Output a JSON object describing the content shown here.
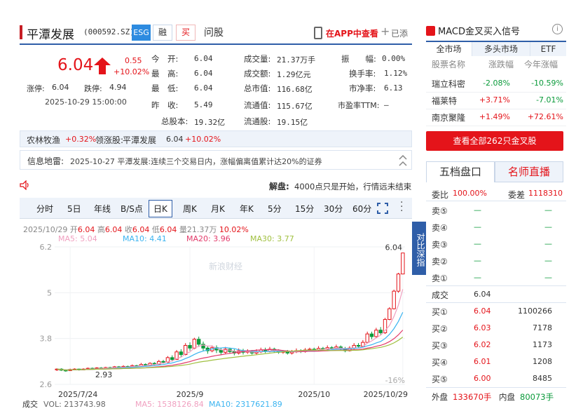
{
  "stock": {
    "name": "平潭发展",
    "code": "(000592.SZ)",
    "tags": [
      "ESG",
      "融",
      "买"
    ],
    "ask_link": "问股",
    "app_link": "在APP中查看",
    "added": "已添",
    "price": "6.04",
    "change": "0.55",
    "change_pct": "+10.02%",
    "limit_up_label": "涨停:",
    "limit_up": "6.04",
    "limit_down_label": "跌停:",
    "limit_down": "4.94",
    "datetime": "2025-10-29 15:00:00"
  },
  "quote": {
    "open_label": "今　开:",
    "open": "6.04",
    "high_label": "最　高:",
    "high": "6.04",
    "low_label": "最　低:",
    "low": "6.04",
    "prev_label": "昨　收:",
    "prev": "5.49",
    "vol_label": "成交量:",
    "vol": "21.37万手",
    "amt_label": "成交额:",
    "amt": "1.29亿元",
    "mcap_label": "总市值:",
    "mcap": "116.68亿",
    "fmcap_label": "流通值:",
    "fmcap": "115.67亿",
    "fshares_label": "流通股:",
    "fshares": "19.15亿",
    "tshares_label": "总股本:",
    "tshares": "19.32亿",
    "amp_label": "振　　幅:",
    "amp": "0.00%",
    "turn_label": "换手率:",
    "turn": "1.12%",
    "pb_label": "市净率:",
    "pb": "6.13",
    "pe_label": "市盈率TTM:",
    "pe": "—"
  },
  "sector": {
    "name": "农林牧渔",
    "pct": "+0.32%",
    "leader_label": "领涨股:",
    "leader": "平潭发展",
    "leader_price": "6.04",
    "leader_pct": "+10.02%"
  },
  "thunder": {
    "label": "信息地雷:",
    "text": "2025-10-27 平潭发展:连续三个交易日内，涨幅偏离值累计达20%的证券"
  },
  "notice": {
    "label": "解盘:",
    "text": "4000点只是开始，行情远未结束"
  },
  "tabs": [
    "分时",
    "5日",
    "年线",
    "B/S点",
    "日K",
    "周K",
    "月K",
    "年K",
    "5分",
    "15分",
    "30分",
    "60分"
  ],
  "chart_info": {
    "date": "2025/10/29",
    "open_label": "开",
    "open": "6.04",
    "high_label": "高",
    "high": "6.04",
    "close_label": "收",
    "close": "6.04",
    "low_label": "低",
    "low": "6.04",
    "vol_label": "量",
    "vol": "21.37万",
    "pct": "10.02%",
    "ma5": "MA5: 5.04",
    "ma10": "MA10: 4.41",
    "ma20": "MA20: 3.96",
    "ma30": "MA30: 3.77",
    "side_btn": "对比深指",
    "watermark": "新浪财经",
    "vol_title": "成交",
    "vol_val": "VOL: 213743.98",
    "vol_ma5": "MA5: 1538126.84",
    "vol_ma10": "MA10: 2317621.89",
    "low_marker": "2.93",
    "high_marker": "6.04",
    "pct_marker": "-16%",
    "colors": {
      "ma5": "#f0a0c0",
      "ma10": "#3bb4f0",
      "ma20": "#e23a6a",
      "ma30": "#a0c040",
      "up": "#e4141a",
      "down": "#0a9a3a"
    }
  },
  "chart_data": {
    "type": "candlestick",
    "y_ticks": [
      "6.2",
      "5",
      "3.8",
      "2.6"
    ],
    "ylim": [
      2.6,
      6.2
    ],
    "x_ticks": [
      "2025/7/24",
      "2025/9",
      "2025/10",
      "2025/10/29"
    ],
    "candles": [
      [
        2.98,
        3.0,
        2.95,
        3.02
      ],
      [
        3.0,
        2.97,
        2.95,
        3.02
      ],
      [
        2.97,
        2.96,
        2.93,
        2.99
      ],
      [
        2.96,
        2.99,
        2.95,
        3.01
      ],
      [
        2.99,
        3.0,
        2.97,
        3.02
      ],
      [
        3.0,
        2.98,
        2.96,
        3.01
      ],
      [
        2.98,
        3.0,
        2.97,
        3.02
      ],
      [
        3.0,
        3.02,
        2.99,
        3.04
      ],
      [
        3.02,
        3.01,
        2.99,
        3.04
      ],
      [
        3.01,
        3.03,
        3.0,
        3.05
      ],
      [
        3.03,
        3.02,
        3.0,
        3.05
      ],
      [
        3.02,
        3.04,
        3.01,
        3.06
      ],
      [
        3.04,
        3.03,
        3.01,
        3.06
      ],
      [
        3.03,
        3.06,
        3.02,
        3.08
      ],
      [
        3.06,
        3.05,
        3.03,
        3.08
      ],
      [
        3.05,
        3.07,
        3.04,
        3.1
      ],
      [
        3.07,
        3.06,
        3.04,
        3.09
      ],
      [
        3.06,
        3.09,
        3.05,
        3.12
      ],
      [
        3.09,
        3.08,
        3.06,
        3.11
      ],
      [
        3.08,
        3.12,
        3.07,
        3.16
      ],
      [
        3.12,
        3.1,
        3.08,
        3.15
      ],
      [
        3.1,
        3.15,
        3.09,
        3.18
      ],
      [
        3.15,
        3.13,
        3.1,
        3.18
      ],
      [
        3.13,
        3.2,
        3.12,
        3.24
      ],
      [
        3.2,
        3.18,
        3.14,
        3.24
      ],
      [
        3.18,
        3.3,
        3.16,
        3.34
      ],
      [
        3.3,
        3.25,
        3.2,
        3.36
      ],
      [
        3.25,
        3.45,
        3.24,
        3.5
      ],
      [
        3.45,
        3.38,
        3.32,
        3.52
      ],
      [
        3.38,
        3.62,
        3.36,
        3.68
      ],
      [
        3.62,
        3.55,
        3.48,
        3.7
      ],
      [
        3.55,
        3.78,
        3.52,
        3.82
      ],
      [
        3.78,
        3.65,
        3.58,
        3.85
      ],
      [
        3.65,
        3.55,
        3.48,
        3.72
      ],
      [
        3.55,
        3.48,
        3.4,
        3.6
      ],
      [
        3.48,
        3.56,
        3.44,
        3.62
      ],
      [
        3.56,
        3.5,
        3.42,
        3.62
      ],
      [
        3.5,
        3.44,
        3.38,
        3.56
      ],
      [
        3.44,
        3.52,
        3.4,
        3.58
      ],
      [
        3.52,
        3.46,
        3.4,
        3.56
      ],
      [
        3.46,
        3.42,
        3.36,
        3.52
      ],
      [
        3.42,
        3.48,
        3.38,
        3.54
      ],
      [
        3.48,
        3.44,
        3.38,
        3.53
      ],
      [
        3.44,
        3.46,
        3.4,
        3.52
      ],
      [
        3.46,
        3.42,
        3.38,
        3.5
      ],
      [
        3.42,
        3.45,
        3.38,
        3.52
      ],
      [
        3.45,
        3.5,
        3.42,
        3.56
      ],
      [
        3.5,
        3.47,
        3.42,
        3.56
      ],
      [
        3.47,
        3.52,
        3.44,
        3.58
      ],
      [
        3.52,
        3.48,
        3.43,
        3.56
      ],
      [
        3.48,
        3.44,
        3.4,
        3.52
      ],
      [
        3.44,
        3.46,
        3.4,
        3.5
      ],
      [
        3.46,
        3.42,
        3.38,
        3.5
      ],
      [
        3.42,
        3.45,
        3.38,
        3.5
      ],
      [
        3.45,
        3.48,
        3.42,
        3.54
      ],
      [
        3.48,
        3.46,
        3.42,
        3.52
      ],
      [
        3.46,
        3.5,
        3.43,
        3.55
      ],
      [
        3.5,
        3.52,
        3.46,
        3.56
      ],
      [
        3.52,
        3.5,
        3.46,
        3.56
      ],
      [
        3.5,
        3.54,
        3.48,
        3.6
      ],
      [
        3.54,
        3.52,
        3.48,
        3.58
      ],
      [
        3.52,
        3.56,
        3.49,
        3.62
      ],
      [
        3.56,
        3.54,
        3.5,
        3.6
      ],
      [
        3.54,
        3.58,
        3.52,
        3.64
      ],
      [
        3.58,
        3.54,
        3.5,
        3.62
      ],
      [
        3.54,
        3.48,
        3.44,
        3.58
      ],
      [
        3.48,
        3.55,
        3.46,
        3.6
      ],
      [
        3.55,
        3.62,
        3.52,
        3.68
      ],
      [
        3.62,
        3.6,
        3.55,
        3.68
      ],
      [
        3.6,
        3.7,
        3.58,
        3.76
      ],
      [
        3.7,
        3.92,
        3.68,
        3.98
      ],
      [
        3.92,
        3.85,
        3.78,
        3.98
      ],
      [
        3.85,
        4.02,
        3.82,
        4.08
      ],
      [
        4.02,
        3.95,
        3.9,
        4.1
      ],
      [
        3.95,
        4.3,
        3.92,
        4.34
      ],
      [
        4.3,
        4.58,
        4.28,
        4.62
      ],
      [
        4.58,
        5.04,
        4.56,
        5.08
      ],
      [
        5.04,
        5.49,
        5.0,
        5.52
      ],
      [
        5.49,
        6.04,
        5.49,
        6.04
      ]
    ]
  },
  "right_panel": {
    "signal_title": "MACD金叉买入信号",
    "info_icon": "i",
    "tabs": [
      "全市场",
      "多头市场",
      "ETF"
    ],
    "headers": [
      "股票名称",
      "涨跌幅",
      "今年涨幅"
    ],
    "rows": [
      {
        "name": "瑞立科密",
        "chg": "-2.08%",
        "ytd": "-10.59%",
        "chg_up": false,
        "ytd_up": false
      },
      {
        "name": "福莱特",
        "chg": "+3.71%",
        "ytd": "-7.01%",
        "chg_up": true,
        "ytd_up": false
      },
      {
        "name": "南京聚隆",
        "chg": "+1.49%",
        "ytd": "+72.61%",
        "chg_up": true,
        "ytd_up": true
      }
    ],
    "view_all": "查看全部262只金叉股",
    "book_tabs": [
      "五档盘口",
      "名师直播"
    ],
    "weibi_label": "委比",
    "weibi": "100.00%",
    "weicha_label": "委差",
    "weicha": "1118310",
    "sells": [
      {
        "label": "卖⑤",
        "price": "—",
        "vol": "—"
      },
      {
        "label": "卖④",
        "price": "—",
        "vol": "—"
      },
      {
        "label": "卖③",
        "price": "—",
        "vol": "—"
      },
      {
        "label": "卖②",
        "price": "—",
        "vol": "—"
      },
      {
        "label": "卖①",
        "price": "—",
        "vol": "—"
      }
    ],
    "deal_label": "成交",
    "deal": "6.04",
    "buys": [
      {
        "label": "买①",
        "price": "6.04",
        "vol": "1100266"
      },
      {
        "label": "买②",
        "price": "6.03",
        "vol": "7178"
      },
      {
        "label": "买③",
        "price": "6.02",
        "vol": "1173"
      },
      {
        "label": "买④",
        "price": "6.01",
        "vol": "1208"
      },
      {
        "label": "买⑤",
        "price": "6.00",
        "vol": "8485"
      }
    ],
    "outer_label": "外盘",
    "outer": "133670手",
    "inner_label": "内盘",
    "inner": "80073手"
  }
}
